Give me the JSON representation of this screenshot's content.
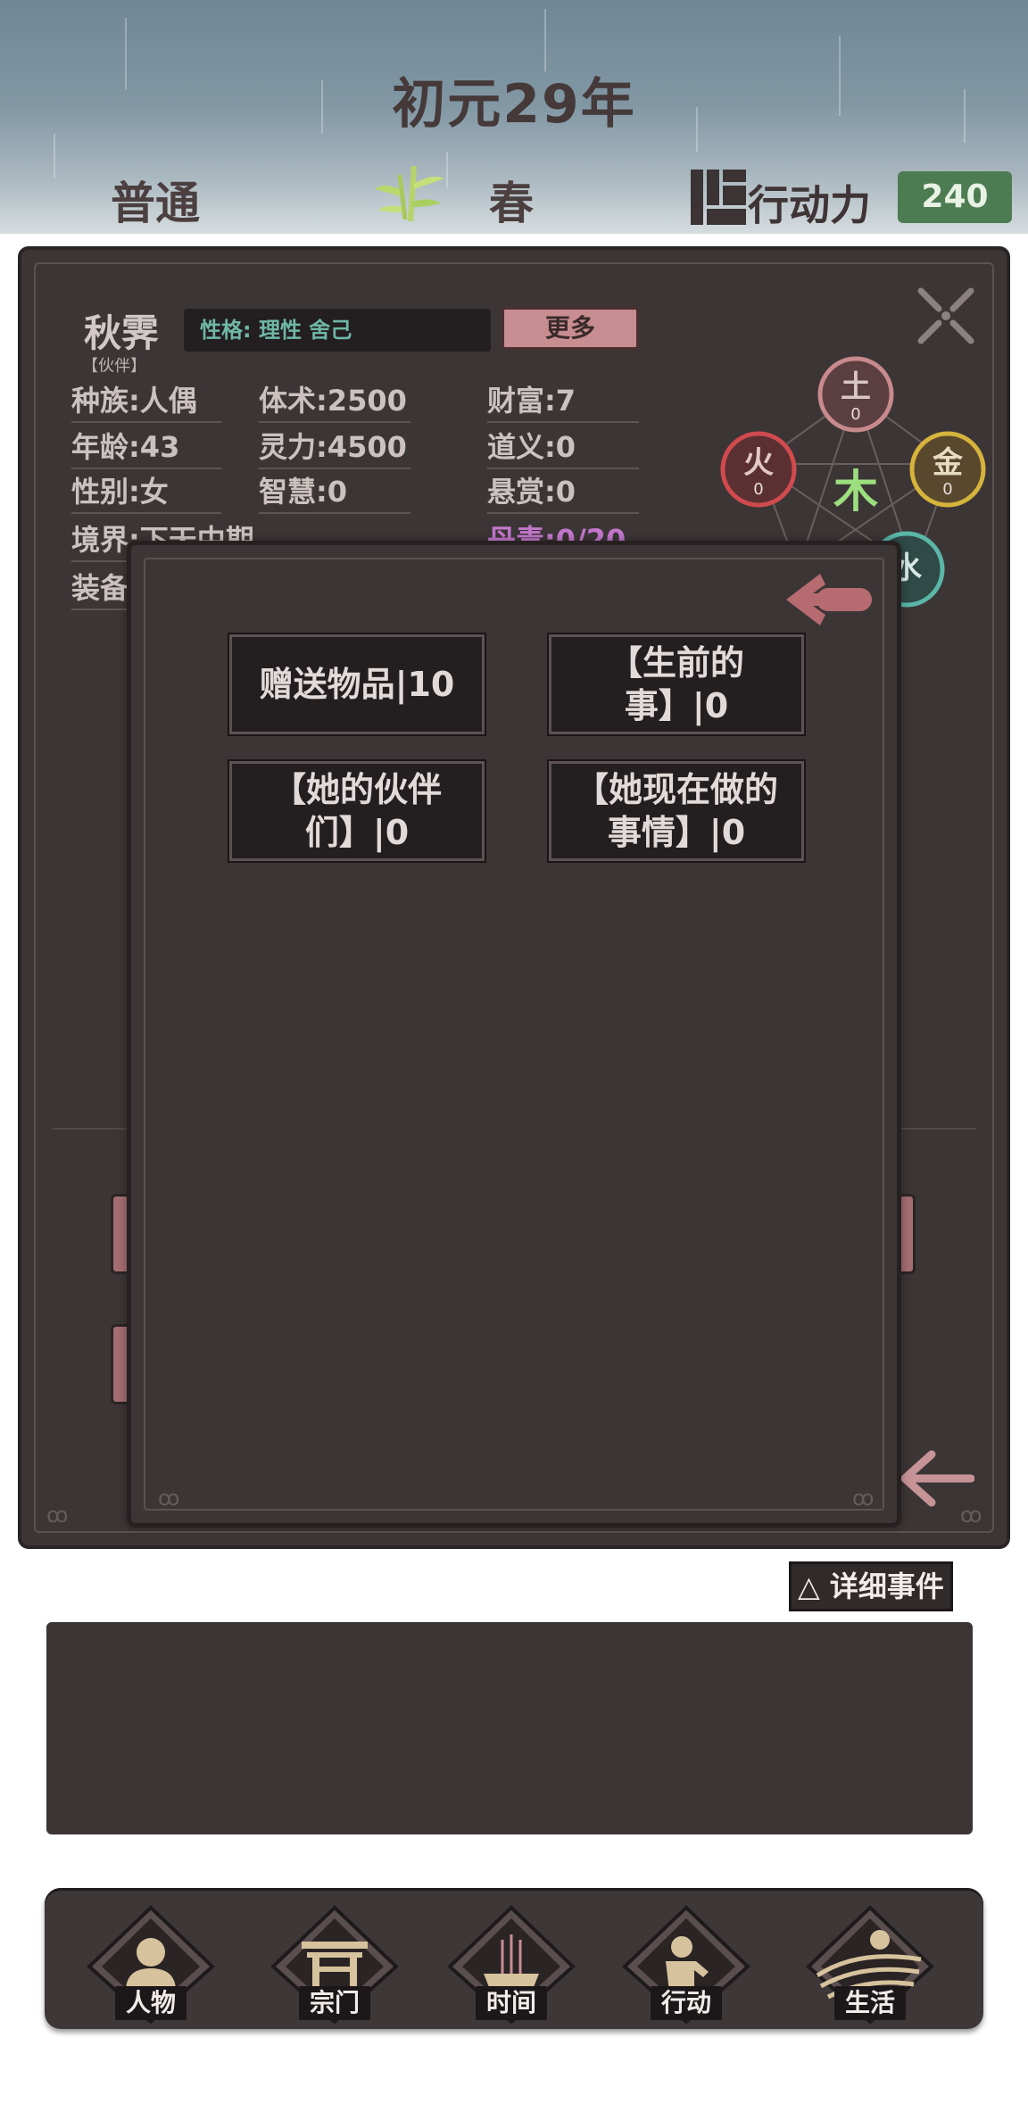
{
  "header": {
    "year_title": "初元29年",
    "difficulty": "普通",
    "season": "春",
    "action_label": "行动力",
    "action_value": "240"
  },
  "character": {
    "name": "秋霁",
    "role": "【伙伴】",
    "personality": "性格: 理性 舍己",
    "more_label": "更多",
    "stats": {
      "race": "种族:人偶",
      "age": "年龄:43",
      "gender": "性别:女",
      "realm": "境界:下天中期",
      "equipment": "装备",
      "body_art": "体术:2500",
      "spirit": "灵力:4500",
      "wisdom": "智慧:0",
      "wealth": "财富:7",
      "morality": "道义:0",
      "bounty": "悬赏:0",
      "poison": "丹毒:0/20"
    },
    "elements": {
      "earth": {
        "label": "土",
        "value": "0",
        "color": "#c88a8c"
      },
      "fire": {
        "label": "火",
        "value": "0",
        "color": "#d04a4e"
      },
      "metal": {
        "label": "金",
        "value": "0",
        "color": "#d6b43c"
      },
      "wood": {
        "label": "木",
        "color": "#9bdf7e"
      },
      "water": {
        "label": "水",
        "color": "#5ab7a8"
      }
    }
  },
  "dialog": {
    "options": [
      {
        "label": "赠送物品|10"
      },
      {
        "label": "【生前的事】|0"
      },
      {
        "label": "【她的伙伴们】|0"
      },
      {
        "label": "【她现在做的事情】|0"
      }
    ]
  },
  "detail_events_label": "△ 详细事件",
  "nav": [
    {
      "label": "人物",
      "icon": "person-icon"
    },
    {
      "label": "宗门",
      "icon": "gate-icon"
    },
    {
      "label": "时间",
      "icon": "incense-icon"
    },
    {
      "label": "行动",
      "icon": "action-icon"
    },
    {
      "label": "生活",
      "icon": "landscape-icon"
    }
  ],
  "colors": {
    "panel_bg": "#3c3536",
    "accent_pink": "#c88d90",
    "action_green": "#4d7b52",
    "personality_teal": "#6fb7a7",
    "poison_purple": "#c377cc"
  }
}
